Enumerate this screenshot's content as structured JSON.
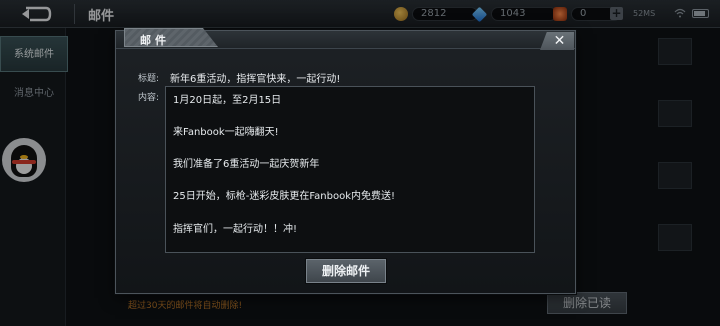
{
  "topbar": {
    "title": "邮件",
    "gold": "2812",
    "diamond": "1043",
    "token": "0",
    "plus_icon": "+",
    "status": "52MS"
  },
  "sidebar": {
    "items": [
      {
        "label": "系统邮件",
        "active": true
      },
      {
        "label": "消息中心",
        "active": false
      }
    ]
  },
  "footer": {
    "expire_note": "超过30天的邮件将自动删除!",
    "delete_read_label": "删除已读"
  },
  "dialog": {
    "tab_label": "邮件",
    "close_icon": "✕",
    "title_label": "标题:",
    "title_value": "新年6重活动，指挥官快来，一起行动!",
    "content_label": "内容:",
    "content_lines": [
      "1月20日起，至2月15日",
      "来Fanbook一起嗨翻天!",
      "我们准备了6重活动一起庆贺新年",
      "25日开始，标枪-迷彩皮肤更在Fanbook内免费送!",
      "指挥官们，一起行动！！冲!"
    ],
    "delete_label": "删除邮件"
  },
  "colors": {
    "background": "#0e1114",
    "dialog_border": "#4c545b",
    "accent_orange": "#c07a2a"
  }
}
